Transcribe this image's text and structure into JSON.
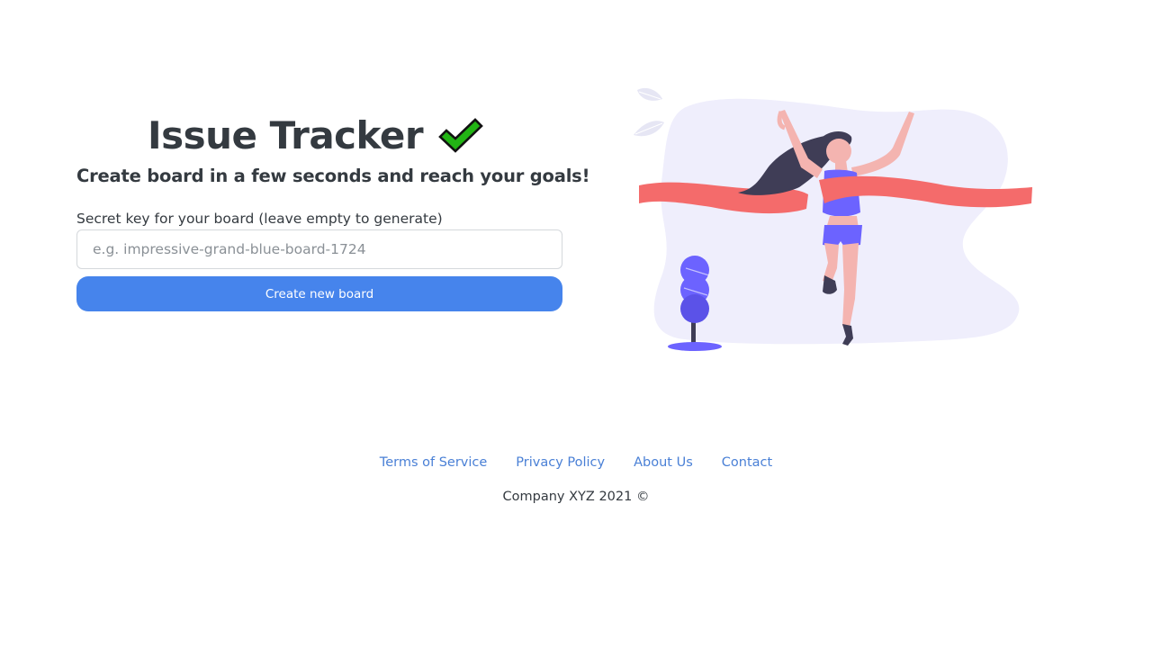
{
  "hero": {
    "title": "Issue Tracker",
    "subtitle": "Create board in a few seconds and reach your goals!"
  },
  "form": {
    "key_label": "Secret key for your board (leave empty to generate)",
    "key_placeholder": "e.g. impressive-grand-blue-board-1724",
    "key_value": "",
    "create_button_label": "Create new board"
  },
  "footer": {
    "links": [
      {
        "label": "Terms of Service"
      },
      {
        "label": "Privacy Policy"
      },
      {
        "label": "About Us"
      },
      {
        "label": "Contact"
      }
    ],
    "copyright": "Company XYZ 2021 ©"
  },
  "icons": {
    "title_icon": "checkmark-icon",
    "illustration": "finish-line-runner-illustration"
  },
  "colors": {
    "text": "#343a40",
    "accent": "#4684ec",
    "link": "#4a80d6",
    "check_green": "#22b414",
    "ribbon": "#f46b6b",
    "purple": "#6c63ff",
    "blob": "#efeefc"
  }
}
